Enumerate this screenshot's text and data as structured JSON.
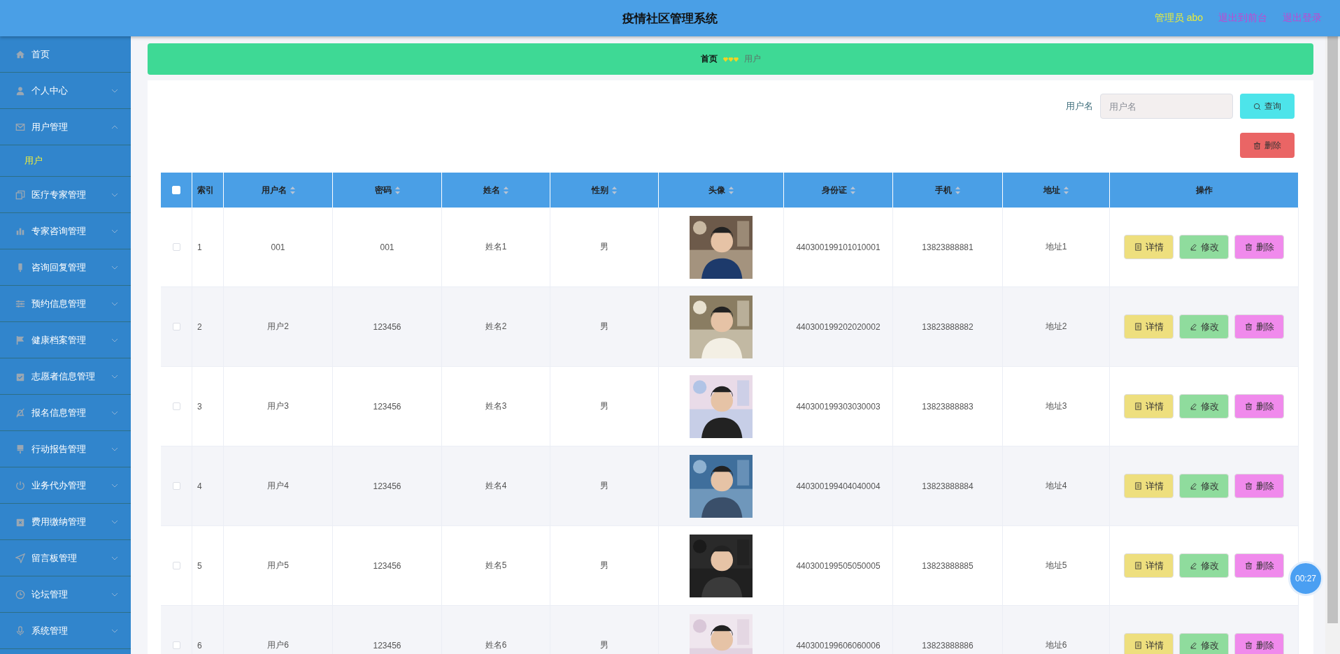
{
  "header": {
    "title": "疫情社区管理系统",
    "user": "管理员 abo",
    "links": [
      "退出到前台",
      "退出登录"
    ]
  },
  "sidebar": {
    "items": [
      {
        "label": "首页"
      },
      {
        "label": "个人中心",
        "expanded": false
      },
      {
        "label": "用户管理",
        "expanded": true,
        "children": [
          {
            "label": "用户",
            "selected": true
          }
        ]
      },
      {
        "label": "医疗专家管理",
        "expanded": false
      },
      {
        "label": "专家咨询管理",
        "expanded": false
      },
      {
        "label": "咨询回复管理",
        "expanded": false
      },
      {
        "label": "预约信息管理",
        "expanded": false
      },
      {
        "label": "健康档案管理",
        "expanded": false
      },
      {
        "label": "志愿者信息管理",
        "expanded": false
      },
      {
        "label": "报名信息管理",
        "expanded": false
      },
      {
        "label": "行动报告管理",
        "expanded": false
      },
      {
        "label": "业务代办管理",
        "expanded": false
      },
      {
        "label": "费用缴纳管理",
        "expanded": false
      },
      {
        "label": "留言板管理",
        "expanded": false
      },
      {
        "label": "论坛管理",
        "expanded": false
      },
      {
        "label": "系统管理",
        "expanded": false
      }
    ]
  },
  "breadcrumb": [
    "首页",
    "用户"
  ],
  "search": {
    "label": "用户名",
    "placeholder": "用户名",
    "button": "查询"
  },
  "delete_button": "删除",
  "table": {
    "columns": [
      {
        "kind": "checkbox",
        "checked": false
      },
      {
        "kind": "text",
        "label": "索引",
        "sortable": false
      },
      {
        "kind": "text",
        "label": "用户名",
        "sortable": true
      },
      {
        "kind": "text",
        "label": "密码",
        "sortable": true
      },
      {
        "kind": "text",
        "label": "姓名",
        "sortable": true
      },
      {
        "kind": "text",
        "label": "性别",
        "sortable": true
      },
      {
        "kind": "text",
        "label": "头像",
        "sortable": true
      },
      {
        "kind": "text",
        "label": "身份证",
        "sortable": true
      },
      {
        "kind": "text",
        "label": "手机",
        "sortable": true
      },
      {
        "kind": "text",
        "label": "地址",
        "sortable": true
      },
      {
        "kind": "text",
        "label": "操作",
        "sortable": false
      }
    ],
    "rows": [
      {
        "checked": false,
        "index": "1",
        "username": "001",
        "password": "001",
        "name": "姓名1",
        "gender": "男",
        "id_card": "440300199101010001",
        "phone": "13823888881",
        "address": "地址1",
        "actions": [
          {
            "kind": "detail",
            "label": "详情"
          },
          {
            "kind": "edit",
            "label": "修改"
          },
          {
            "kind": "delete",
            "label": "删除"
          }
        ]
      },
      {
        "checked": false,
        "index": "2",
        "username": "用户2",
        "password": "123456",
        "name": "姓名2",
        "gender": "男",
        "id_card": "440300199202020002",
        "phone": "13823888882",
        "address": "地址2",
        "actions": [
          {
            "kind": "detail",
            "label": "详情"
          },
          {
            "kind": "edit",
            "label": "修改"
          },
          {
            "kind": "delete",
            "label": "删除"
          }
        ]
      },
      {
        "checked": false,
        "index": "3",
        "username": "用户3",
        "password": "123456",
        "name": "姓名3",
        "gender": "男",
        "id_card": "440300199303030003",
        "phone": "13823888883",
        "address": "地址3",
        "actions": [
          {
            "kind": "detail",
            "label": "详情"
          },
          {
            "kind": "edit",
            "label": "修改"
          },
          {
            "kind": "delete",
            "label": "删除"
          }
        ]
      },
      {
        "checked": false,
        "index": "4",
        "username": "用户4",
        "password": "123456",
        "name": "姓名4",
        "gender": "男",
        "id_card": "440300199404040004",
        "phone": "13823888884",
        "address": "地址4",
        "actions": [
          {
            "kind": "detail",
            "label": "详情"
          },
          {
            "kind": "edit",
            "label": "修改"
          },
          {
            "kind": "delete",
            "label": "删除"
          }
        ]
      },
      {
        "checked": false,
        "index": "5",
        "username": "用户5",
        "password": "123456",
        "name": "姓名5",
        "gender": "男",
        "id_card": "440300199505050005",
        "phone": "13823888885",
        "address": "地址5",
        "actions": [
          {
            "kind": "detail",
            "label": "详情"
          },
          {
            "kind": "edit",
            "label": "修改"
          },
          {
            "kind": "delete",
            "label": "删除"
          }
        ]
      },
      {
        "checked": false,
        "index": "6",
        "username": "用户6",
        "password": "123456",
        "name": "姓名6",
        "gender": "男",
        "id_card": "440300199606060006",
        "phone": "13823888886",
        "address": "地址6",
        "actions": [
          {
            "kind": "detail",
            "label": "详情"
          },
          {
            "kind": "edit",
            "label": "修改"
          },
          {
            "kind": "delete",
            "label": "删除"
          }
        ]
      }
    ]
  },
  "timer": "00:27"
}
